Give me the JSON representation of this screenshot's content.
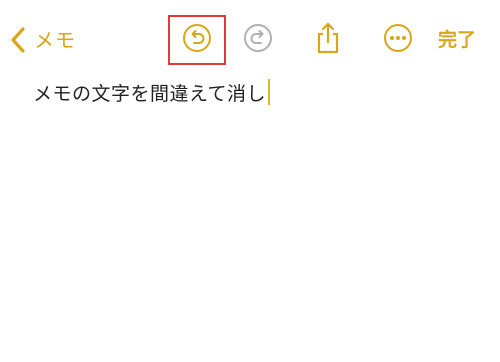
{
  "header": {
    "back_label": "メモ",
    "done_label": "完了"
  },
  "note": {
    "text": "メモの文字を間違えて消し"
  },
  "icons": {
    "back": "chevron-left-icon",
    "undo": "undo-icon",
    "redo": "redo-icon",
    "share": "share-icon",
    "more": "more-icon"
  },
  "colors": {
    "accent": "#d9a619",
    "disabled": "#b0b0b0",
    "highlight_box": "#e53935",
    "cursor": "#e6b422"
  },
  "state": {
    "redo_enabled": false
  }
}
